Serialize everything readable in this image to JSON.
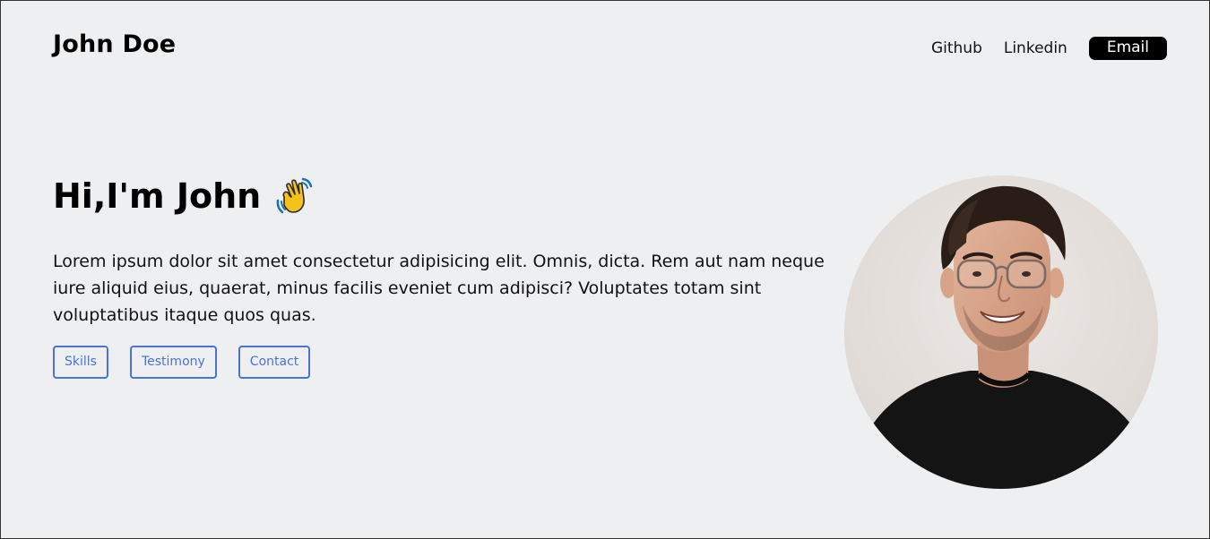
{
  "header": {
    "brand": "John Doe",
    "nav": {
      "github": "Github",
      "linkedin": "Linkedin",
      "email": "Email"
    }
  },
  "hero": {
    "title": "Hi,I'm John",
    "wave_icon": "waving-hand-icon",
    "description": "Lorem ipsum dolor sit amet consectetur adipisicing elit. Omnis, dicta. Rem aut nam neque iure aliquid eius, quaerat, minus facilis eveniet cum adipisci? Voluptates totam sint voluptatibus itaque quos quas.",
    "buttons": {
      "skills": "Skills",
      "testimony": "Testimony",
      "contact": "Contact"
    }
  },
  "colors": {
    "background": "#eeeff1",
    "accent": "#4a72d8",
    "email_button": "#000000"
  }
}
